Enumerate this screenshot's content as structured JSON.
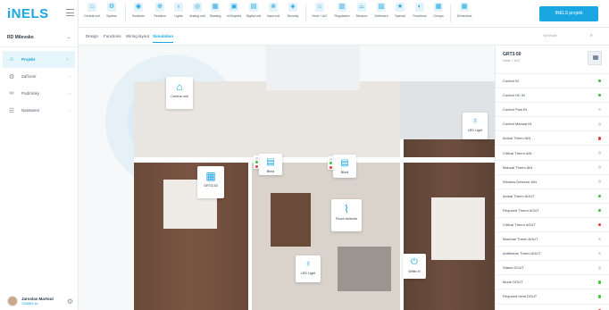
{
  "app": {
    "logo": "iNELS"
  },
  "sidebar": {
    "site": "RD Milevsko",
    "items": [
      {
        "label": "Projekt",
        "icon": "home-icon",
        "active": true
      },
      {
        "label": "Zařízení",
        "icon": "devices-icon",
        "active": false
      },
      {
        "label": "Podmínky",
        "icon": "conditions-icon",
        "active": false
      },
      {
        "label": "Nastavení",
        "icon": "sliders-icon",
        "active": false
      }
    ],
    "user": {
      "name": "Jaroslav Martoul",
      "id": "105883.sk"
    }
  },
  "toolbar": {
    "groups": [
      {
        "label": "Central unit",
        "icon": "central-unit-icon"
      },
      {
        "label": "System",
        "icon": "system-icon"
      },
      {
        "label": "Switches",
        "icon": "switch-icon"
      },
      {
        "label": "Readers",
        "icon": "reader-icon"
      },
      {
        "label": "Lights",
        "icon": "bulb-icon"
      },
      {
        "label": "Analog unit",
        "icon": "analog-icon"
      },
      {
        "label": "Shading",
        "icon": "shading-icon"
      },
      {
        "label": "In/Outputs",
        "icon": "io-icon"
      },
      {
        "label": "Digital unit",
        "icon": "digital-icon"
      },
      {
        "label": "Input unit",
        "icon": "input-icon"
      },
      {
        "label": "Security",
        "icon": "shield-icon"
      },
      {
        "label": "Heat + A/C",
        "icon": "heat-icon"
      },
      {
        "label": "Regulators",
        "icon": "regulator-icon"
      },
      {
        "label": "Sensors",
        "icon": "sensor-icon"
      },
      {
        "label": "Detectors",
        "icon": "detector-icon"
      },
      {
        "label": "Special",
        "icon": "star-icon"
      },
      {
        "label": "Functions",
        "icon": "function-icon"
      },
      {
        "label": "Groups",
        "icon": "groups-icon"
      },
      {
        "label": "All devices",
        "icon": "all-devices-icon"
      }
    ],
    "cta": "INELS projekt"
  },
  "subtabs": [
    {
      "label": "Design",
      "active": false
    },
    {
      "label": "Functions",
      "active": false
    },
    {
      "label": "Wiring layout",
      "active": false
    },
    {
      "label": "Simulation",
      "active": true
    }
  ],
  "search": {
    "placeholder": "Vyhledat"
  },
  "devices": [
    {
      "label": "Central unit",
      "icon": "home-icon"
    },
    {
      "label": "LED Light",
      "icon": "bulb-icon"
    },
    {
      "label": "Blind",
      "icon": "blind-icon"
    },
    {
      "label": "Blind",
      "icon": "blind-icon"
    },
    {
      "label": "GRT3-50",
      "icon": "thermostat-icon"
    },
    {
      "label": "Flood detector",
      "icon": "thermometer-icon"
    },
    {
      "label": "LED Light",
      "icon": "bulb-icon"
    },
    {
      "label": "Wifile-H",
      "icon": "power-icon"
    }
  ],
  "panel": {
    "title": "GRT3-50",
    "subtitle": "Heat + A/C",
    "rows": [
      {
        "label": "Control IN",
        "status": "on"
      },
      {
        "label": "Control HC IN",
        "status": "on"
      },
      {
        "label": "Control Plan IN",
        "status": "off"
      },
      {
        "label": "Control Manual IN",
        "status": "off"
      },
      {
        "label": "Actual Therm AIN",
        "status": "alert"
      },
      {
        "label": "Critical Therm AIN",
        "status": "off"
      },
      {
        "label": "Manual Therm AIN",
        "status": "off"
      },
      {
        "label": "Window Detector AIN",
        "status": "off"
      },
      {
        "label": "Actual Therm AOUT",
        "status": "on"
      },
      {
        "label": "Required Therm AOUT",
        "status": "on"
      },
      {
        "label": "Critical Therm AOUT",
        "status": "alert"
      },
      {
        "label": "Maximal Therm AOUT",
        "status": "off"
      },
      {
        "label": "Antifreeze Therm AOUT",
        "status": "off"
      },
      {
        "label": "Status DOUT",
        "status": "off"
      },
      {
        "label": "Mode DOUT",
        "status": "on"
      },
      {
        "label": "Required Heat DOUT",
        "status": "on"
      },
      {
        "label": "Holiday DOUT",
        "status": "alert"
      }
    ]
  },
  "colors": {
    "accent": "#1aa6e0",
    "on": "#3cc13b",
    "alert": "#e53935",
    "off": "#d5dbe1"
  }
}
